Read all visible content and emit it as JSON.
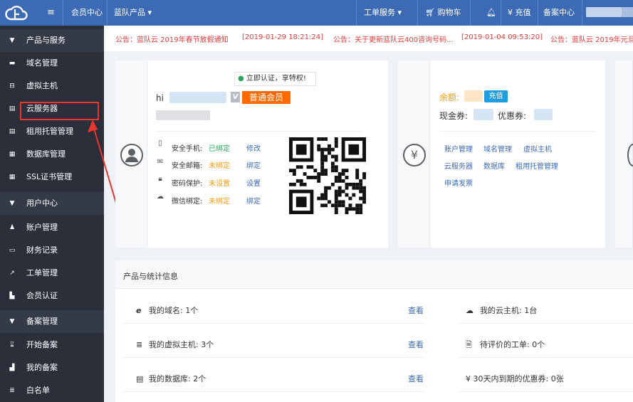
{
  "topbar": {
    "member_center": "会员中心",
    "products_menu": "蓝队产品",
    "ticket_menu": "工单服务",
    "cart": "购物车",
    "recharge": "充值",
    "filing_center": "备案中心",
    "colors": {
      "bar": "#3c6ab5"
    }
  },
  "sidebar": {
    "sections": [
      {
        "label": "产品与服务",
        "icon": "caret-down-icon",
        "items": [
          {
            "label": "域名管理",
            "icon": "domain-icon"
          },
          {
            "label": "虚拟主机",
            "icon": "host-icon"
          },
          {
            "label": "云服务器",
            "icon": "server-icon"
          },
          {
            "label": "租用托管管理",
            "icon": "rack-icon"
          },
          {
            "label": "数据库管理",
            "icon": "database-icon"
          },
          {
            "label": "SSL证书管理",
            "icon": "certificate-icon"
          }
        ]
      },
      {
        "label": "用户中心",
        "icon": "caret-down-icon",
        "items": [
          {
            "label": "账户管理",
            "icon": "user-icon"
          },
          {
            "label": "财务记录",
            "icon": "finance-icon"
          },
          {
            "label": "工单管理",
            "icon": "ticket-icon"
          },
          {
            "label": "会员认证",
            "icon": "certify-icon"
          }
        ]
      },
      {
        "label": "备案管理",
        "icon": "caret-down-icon",
        "items": [
          {
            "label": "开始备案",
            "icon": "hourglass-icon"
          },
          {
            "label": "我的备案",
            "icon": "chart-icon"
          },
          {
            "label": "白名单",
            "icon": "list-icon"
          }
        ]
      }
    ]
  },
  "notices": [
    {
      "text": "公告：蓝队云 2019年春节放假通知",
      "time": "[2019-01-29 18:21:24]"
    },
    {
      "text": "公告：关于更新蓝队云400咨询号码...",
      "time": "[2019-01-04 09:53:20]"
    },
    {
      "text": "公告：蓝队云 2019年元旦"
    }
  ],
  "profile": {
    "verify_tip": "立即认证，享特权!",
    "greeting": "hi",
    "member_level": "普通会员",
    "security": [
      {
        "label": "安全手机:",
        "status": "已绑定",
        "action": "修改",
        "icon": "phone-icon",
        "state": "ok"
      },
      {
        "label": "安全邮箱:",
        "status": "未绑定",
        "action": "绑定",
        "icon": "mail-icon",
        "state": "warn"
      },
      {
        "label": "密码保护:",
        "status": "未设置",
        "action": "设置",
        "icon": "lock-icon",
        "state": "warn"
      },
      {
        "label": "微信绑定:",
        "status": "未绑定",
        "action": "绑定",
        "icon": "wechat-icon",
        "state": "warn"
      }
    ]
  },
  "finance": {
    "balance_label": "余额:",
    "recharge_button": "充值",
    "cash_coupon": "现金券:",
    "discount_coupon": "优惠券:",
    "links": [
      "账户管理",
      "域名管理",
      "虚拟主机",
      "云服务器",
      "数据库",
      "租用托管管理",
      "申请发票"
    ]
  },
  "stats": {
    "title": "产品与统计信息",
    "left": [
      {
        "text": "我的域名: 1个",
        "link": "查看",
        "icon": "ie-icon"
      },
      {
        "text": "我的虚拟主机: 3个",
        "link": "查看",
        "icon": "list-icon"
      },
      {
        "text": "我的数据库: 2个",
        "link": "查看",
        "icon": "database-icon"
      }
    ],
    "right": [
      {
        "text": "我的云主机: 1台",
        "icon": "cloud-icon"
      },
      {
        "text": "待评价的工单: 0个",
        "icon": "document-icon"
      },
      {
        "text": "¥ 30天内到期的优惠券: 0张",
        "icon": "yen-icon"
      }
    ]
  }
}
